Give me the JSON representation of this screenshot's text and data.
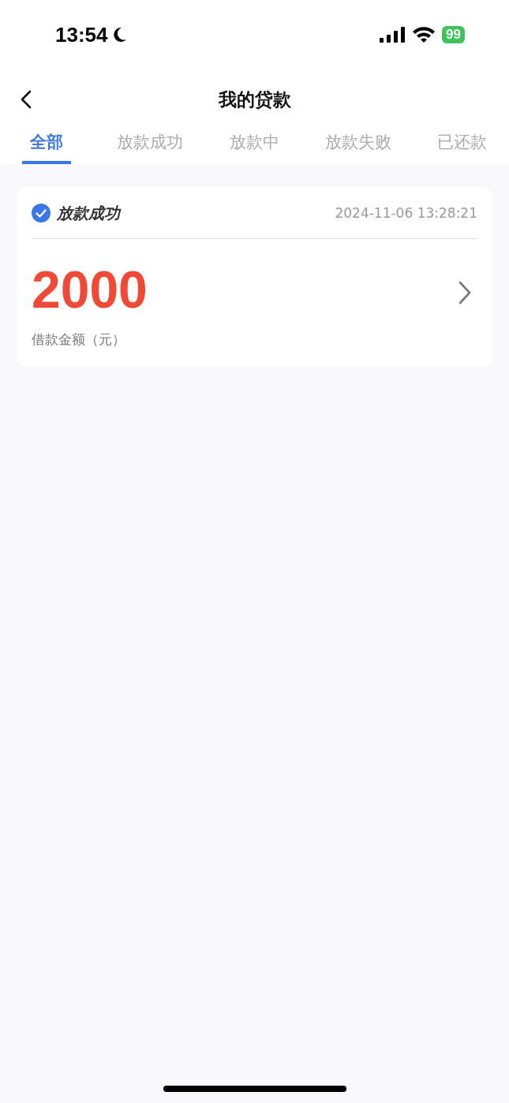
{
  "status_bar": {
    "time": "13:54",
    "battery": "99"
  },
  "nav": {
    "title": "我的贷款"
  },
  "tabs": [
    {
      "label": "全部",
      "selected": true
    },
    {
      "label": "放款成功",
      "selected": false
    },
    {
      "label": "放款中",
      "selected": false
    },
    {
      "label": "放款失败",
      "selected": false
    },
    {
      "label": "已还款",
      "selected": false
    }
  ],
  "loans": [
    {
      "status": "放款成功",
      "time": "2024-11-06 13:28:21",
      "amount": "2000",
      "amount_label": "借款金额（元）"
    }
  ]
}
